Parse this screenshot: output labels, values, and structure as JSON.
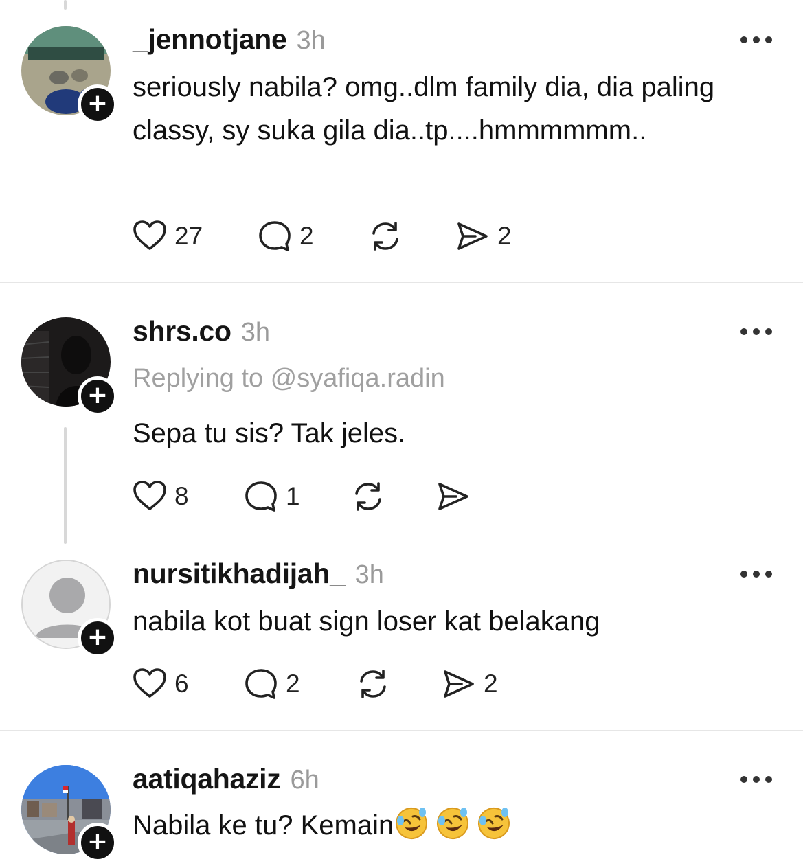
{
  "posts": [
    {
      "username": "_jennotjane",
      "time": "3h",
      "text": "seriously nabila? omg..dlm family dia, dia paling classy, sy suka gila dia..tp....hmmmmmm..",
      "likes": "27",
      "replies": "2",
      "shares": "2"
    },
    {
      "username": "shrs.co",
      "time": "3h",
      "reply_to": "Replying to @syafiqa.radin",
      "text": "Sepa tu sis? Tak jeles.",
      "likes": "8",
      "replies": "1"
    },
    {
      "username": "nursitikhadijah_",
      "time": "3h",
      "text": "nabila kot buat sign loser kat belakang",
      "likes": "6",
      "replies": "2",
      "shares": "2"
    },
    {
      "username": "aatiqahaziz",
      "time": "6h",
      "text": "Nabila ke tu? Kemain",
      "emoji": "🤣🤣🤣"
    }
  ],
  "icons": {
    "like": "heart-icon",
    "reply": "comment-icon",
    "repost": "repost-icon",
    "share": "send-icon",
    "more": "more-icon",
    "follow": "plus-icon"
  },
  "colors": {
    "text": "#111111",
    "muted": "#9a9a9a",
    "divider": "#e6e6e6",
    "badge": "#111111"
  }
}
